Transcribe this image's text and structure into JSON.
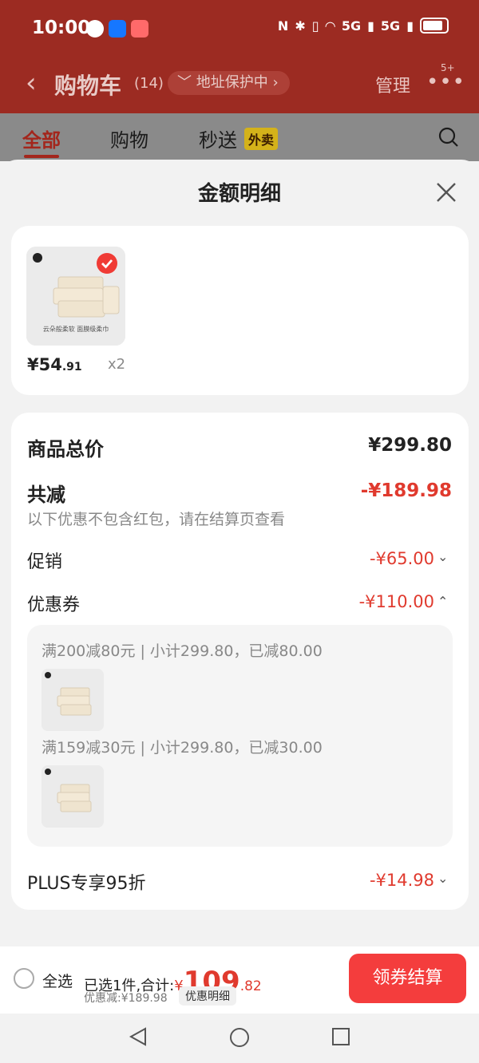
{
  "status_bar": {
    "time": "10:00",
    "network_1": "5G",
    "network_2": "5G"
  },
  "header": {
    "title": "购物车",
    "count": "(14)",
    "address_protect": "地址保护中",
    "manage": "管理",
    "more_badge": "5+"
  },
  "tabs": [
    {
      "label": "全部"
    },
    {
      "label": "购物"
    },
    {
      "label": "秒送"
    }
  ],
  "tab_badge": "外卖",
  "sheet": {
    "title": "金额明细"
  },
  "product": {
    "price_int": "¥54",
    "price_dec": ".91",
    "qty": "x2",
    "image_caption": "云朵般柔软 面膜级柔巾"
  },
  "summary": {
    "total_label": "商品总价",
    "total_value": "¥299.80",
    "reduce_label": "共减",
    "reduce_value": "-¥189.98",
    "note": "以下优惠不包含红包，请在结算页查看",
    "promo_label": "促销",
    "promo_value": "-¥65.00",
    "coupon_label": "优惠券",
    "coupon_value": "-¥110.00",
    "coupons": [
      {
        "text": "满200减80元 | 小计299.80，已减80.00"
      },
      {
        "text": "满159减30元 | 小计299.80，已减30.00"
      }
    ],
    "plus_label": "PLUS专享95折",
    "plus_value": "-¥14.98"
  },
  "footer": {
    "select_all": "全选",
    "selected_text": "已选1件,合计:",
    "currency": "¥",
    "total_int": "109",
    "total_dec": ".82",
    "discount_text": "优惠减:¥189.98",
    "detail_button": "优惠明细",
    "checkout_button": "领券结算"
  },
  "colors": {
    "accent_red": "#e03a2e",
    "header_bg": "#9c2b22",
    "checkout_bg": "#f43d3d"
  },
  "icons": [
    "back-icon",
    "chevron-down-icon",
    "more-icon",
    "search-icon",
    "close-icon",
    "check-icon",
    "nav-back-icon",
    "nav-home-icon",
    "nav-recent-icon"
  ]
}
